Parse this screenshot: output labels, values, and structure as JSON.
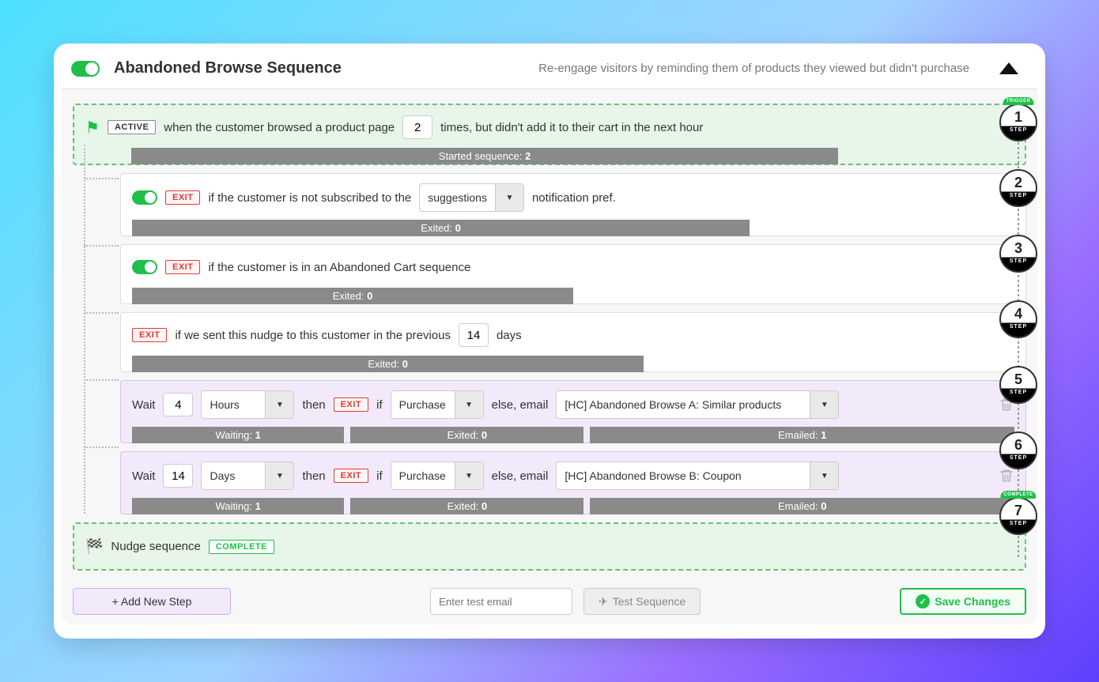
{
  "header": {
    "title": "Abandoned Browse Sequence",
    "description": "Re-engage visitors by reminding them of products they viewed but didn't purchase"
  },
  "trigger": {
    "badge": "ACTIVE",
    "text_before": "when the customer browsed a product page",
    "times": "2",
    "text_after": "times, but didn't add it to their cart in the next hour",
    "stat_label": "Started sequence:",
    "stat_value": "2"
  },
  "exits": [
    {
      "has_toggle": true,
      "badge": "EXIT",
      "text": "if the customer is not subscribed to the",
      "select_value": "suggestions",
      "text_after": "notification pref.",
      "stat_label": "Exited:",
      "stat_value": "0",
      "stat_width_class": "sw1"
    },
    {
      "has_toggle": true,
      "badge": "EXIT",
      "text": "if the customer is in an Abandoned Cart sequence",
      "stat_label": "Exited:",
      "stat_value": "0",
      "stat_width_class": "sw2"
    },
    {
      "has_toggle": false,
      "badge": "EXIT",
      "text_before": "if we sent this nudge to this customer in the previous",
      "days": "14",
      "text_after": "days",
      "stat_label": "Exited:",
      "stat_value": "0",
      "stat_width_class": "sw3"
    }
  ],
  "waits": [
    {
      "wait_label": "Wait",
      "wait_value": "4",
      "wait_unit": "Hours",
      "then": "then",
      "exit_badge": "EXIT",
      "if": "if",
      "if_select": "Purchase",
      "else": "else, email",
      "email_select": "[HC] Abandoned Browse A: Similar products",
      "stats": [
        {
          "label": "Waiting:",
          "value": "1"
        },
        {
          "label": "Exited:",
          "value": "0"
        },
        {
          "label": "Emailed:",
          "value": "1"
        }
      ]
    },
    {
      "wait_label": "Wait",
      "wait_value": "14",
      "wait_unit": "Days",
      "then": "then",
      "exit_badge": "EXIT",
      "if": "if",
      "if_select": "Purchase",
      "else": "else, email",
      "email_select": "[HC] Abandoned Browse B: Coupon",
      "stats": [
        {
          "label": "Waiting:",
          "value": "1"
        },
        {
          "label": "Exited:",
          "value": "0"
        },
        {
          "label": "Emailed:",
          "value": "0"
        }
      ]
    }
  ],
  "complete": {
    "text": "Nudge sequence",
    "badge": "COMPLETE"
  },
  "footer": {
    "add_step": "+ Add New Step",
    "test_placeholder": "Enter test email",
    "test_button": "Test Sequence",
    "save_button": "Save Changes"
  },
  "rail": {
    "trigger_badge": "TRIGGER",
    "complete_badge": "COMPLETE",
    "step_label": "STEP"
  }
}
